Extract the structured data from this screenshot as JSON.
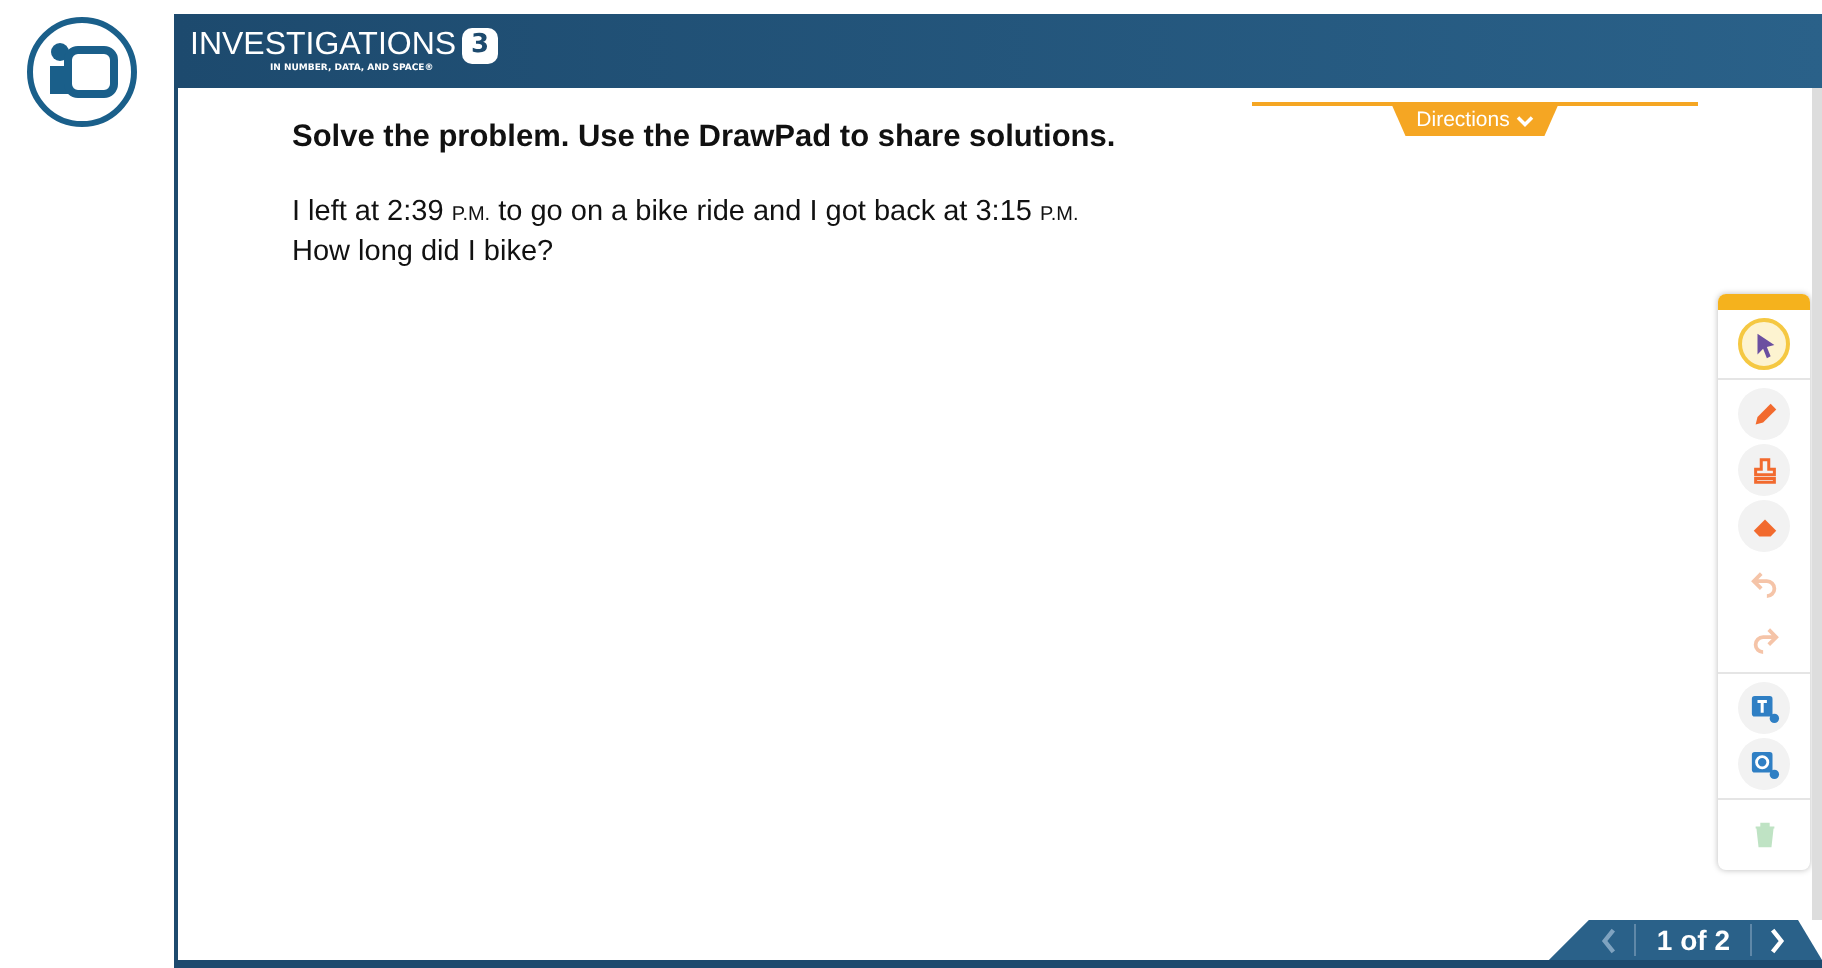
{
  "header": {
    "brand": "INVESTIGATIONS",
    "badge": "3",
    "tagline": "IN NUMBER, DATA, AND SPACE®"
  },
  "instruction": "Solve the problem. Use the DrawPad to share solutions.",
  "directions": {
    "label": "Directions",
    "expanded": false
  },
  "problem": [
    [
      {
        "text": "I left at 2:39 ",
        "small": false
      },
      {
        "text": "P.M.",
        "small": true
      },
      {
        "text": " to go on a bike ride and I got back at 3:15 ",
        "small": false
      },
      {
        "text": "P.M.",
        "small": true
      }
    ],
    [
      {
        "text": "How long did I bike?",
        "small": false
      }
    ]
  ],
  "tool_groups": [
    [
      {
        "kind": "select",
        "selected": true,
        "disabled": false
      }
    ],
    [
      {
        "kind": "pencil",
        "selected": false,
        "disabled": false
      },
      {
        "kind": "stamp",
        "selected": false,
        "disabled": false
      },
      {
        "kind": "eraser",
        "selected": false,
        "disabled": false
      },
      {
        "kind": "undo",
        "selected": false,
        "disabled": true
      },
      {
        "kind": "redo",
        "selected": false,
        "disabled": true
      }
    ],
    [
      {
        "kind": "text",
        "selected": false,
        "disabled": false
      },
      {
        "kind": "shape",
        "selected": false,
        "disabled": false
      }
    ],
    [
      {
        "kind": "trash",
        "selected": false,
        "disabled": true
      }
    ]
  ],
  "pager": {
    "label": "1 of 2",
    "prev_disabled": true
  }
}
